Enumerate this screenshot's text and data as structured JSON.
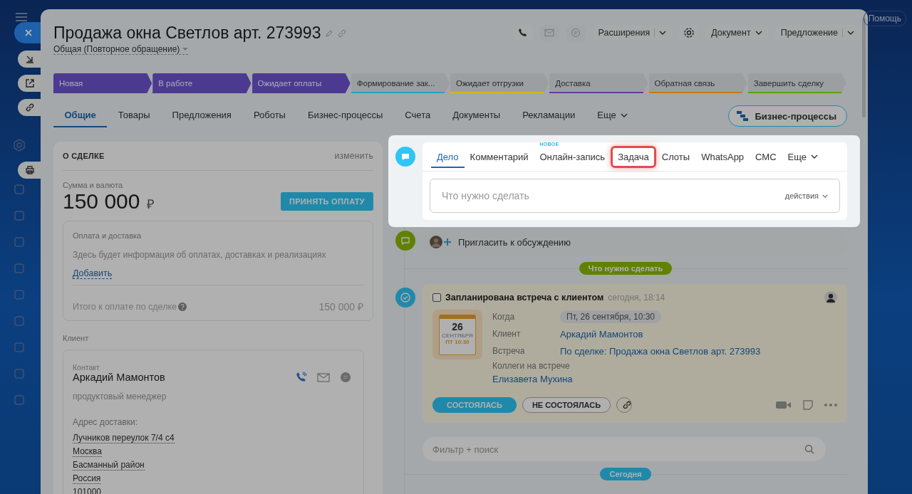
{
  "help": "Помощь",
  "window": {
    "title": "Продажа окна Светлов арт. 273993",
    "category": "Общая (Повторное обращение)"
  },
  "contact_buttons": [
    {
      "kind": "phone",
      "disabled": false
    },
    {
      "kind": "mail",
      "disabled": true
    },
    {
      "kind": "chat",
      "disabled": true
    }
  ],
  "toolbar": [
    {
      "kind": "split",
      "label": "Расширения"
    },
    {
      "kind": "gear"
    },
    {
      "kind": "dropdown",
      "label": "Документ"
    },
    {
      "kind": "split",
      "label": "Предложение"
    }
  ],
  "stages": [
    {
      "label": "Новая",
      "color": "#4c3a91",
      "passed": true
    },
    {
      "label": "В работе",
      "color": "#4c3a91",
      "passed": true
    },
    {
      "label": "Ожидает оплаты",
      "color": "#4c3a91",
      "passed": true
    },
    {
      "label": "Формирование зак...",
      "color": "#22a6c2",
      "passed": false
    },
    {
      "label": "Ожидает отгрузки",
      "color": "#c9bc1a",
      "passed": false
    },
    {
      "label": "Доставка",
      "color": "#6a3aa0",
      "passed": false
    },
    {
      "label": "Обратная связь",
      "color": "#c97b12",
      "passed": false
    },
    {
      "label": "Завершить сделку",
      "color": "#5ea000",
      "passed": false
    }
  ],
  "tabs": [
    {
      "label": "Общие",
      "selected": true
    },
    {
      "label": "Товары",
      "selected": false
    },
    {
      "label": "Предложения",
      "selected": false
    },
    {
      "label": "Роботы",
      "selected": false
    },
    {
      "label": "Бизнес-процессы",
      "selected": false
    },
    {
      "label": "Счета",
      "selected": false
    },
    {
      "label": "Документы",
      "selected": false
    },
    {
      "label": "Рекламации",
      "selected": false
    },
    {
      "label": "Еще",
      "selected": false,
      "kind": "more"
    }
  ],
  "bp_button": "Бизнес-процессы",
  "deal": {
    "heading": "О СДЕЛКЕ",
    "edit_link": "изменить",
    "amount_label": "Сумма и валюта",
    "amount": "150 000",
    "currency": "₽",
    "pay_button": "ПРИНЯТЬ ОПЛАТУ",
    "payment": {
      "title": "Оплата и доставка",
      "info": "Здесь будет информация об оплатах, доставках и реализациях",
      "add_link": "Добавить",
      "total_label": "Итого к оплате по сделке",
      "total": "150 000 ₽"
    },
    "client_label": "Клиент",
    "contact": {
      "label": "Контакт",
      "name": "Аркадий Мамонтов",
      "position": "продуктовый менеджер",
      "address_label": "Адрес доставки:",
      "address": [
        "Лучников переулок 7/4 с4",
        "Москва",
        "Басманный район",
        "Россия",
        "101000"
      ]
    }
  },
  "editor": {
    "tabs": [
      {
        "label": "Дело",
        "selected": true,
        "highlighted": false
      },
      {
        "label": "Комментарий",
        "selected": false,
        "highlighted": false
      },
      {
        "label": "Онлайн-запись",
        "selected": false,
        "highlighted": false,
        "badge": "НОВОЕ"
      },
      {
        "label": "Задача",
        "selected": false,
        "highlighted": true
      },
      {
        "label": "Слоты",
        "selected": false,
        "highlighted": false
      },
      {
        "label": "WhatsApp",
        "selected": false,
        "highlighted": false
      },
      {
        "label": "СМС",
        "selected": false,
        "highlighted": false
      },
      {
        "label": "Еще",
        "selected": false,
        "highlighted": false,
        "kind": "more"
      }
    ],
    "placeholder": "Что нужно сделать",
    "actions": "действия"
  },
  "invite": "Пригласить к обсуждению",
  "todo_pill": "Что нужно сделать",
  "activity": {
    "checked": false,
    "title": "Запланирована встреча с клиентом",
    "time": "сегодня, 18:14",
    "calendar": {
      "day": "26",
      "month": "СЕНТЯБРЯ",
      "time": "ПТ 10:30"
    },
    "fields": [
      {
        "label": "Когда",
        "value": "Пт, 26 сентября, 10:30",
        "kind": "chip"
      },
      {
        "label": "Клиент",
        "value": "Аркадий Мамонтов",
        "kind": "link"
      },
      {
        "label": "Встреча",
        "value": "По сделке: Продажа окна Светлов арт. 273993",
        "kind": "link"
      },
      {
        "label": "Коллеги на встрече",
        "value": "Елизавета Мухина",
        "kind": "stacked"
      }
    ],
    "done_button": "СОСТОЯЛАСЬ",
    "not_done_button": "НЕ СОСТОЯЛАСЬ"
  },
  "filter": {
    "placeholder": "Фильтр + поиск"
  },
  "today": "Сегодня"
}
